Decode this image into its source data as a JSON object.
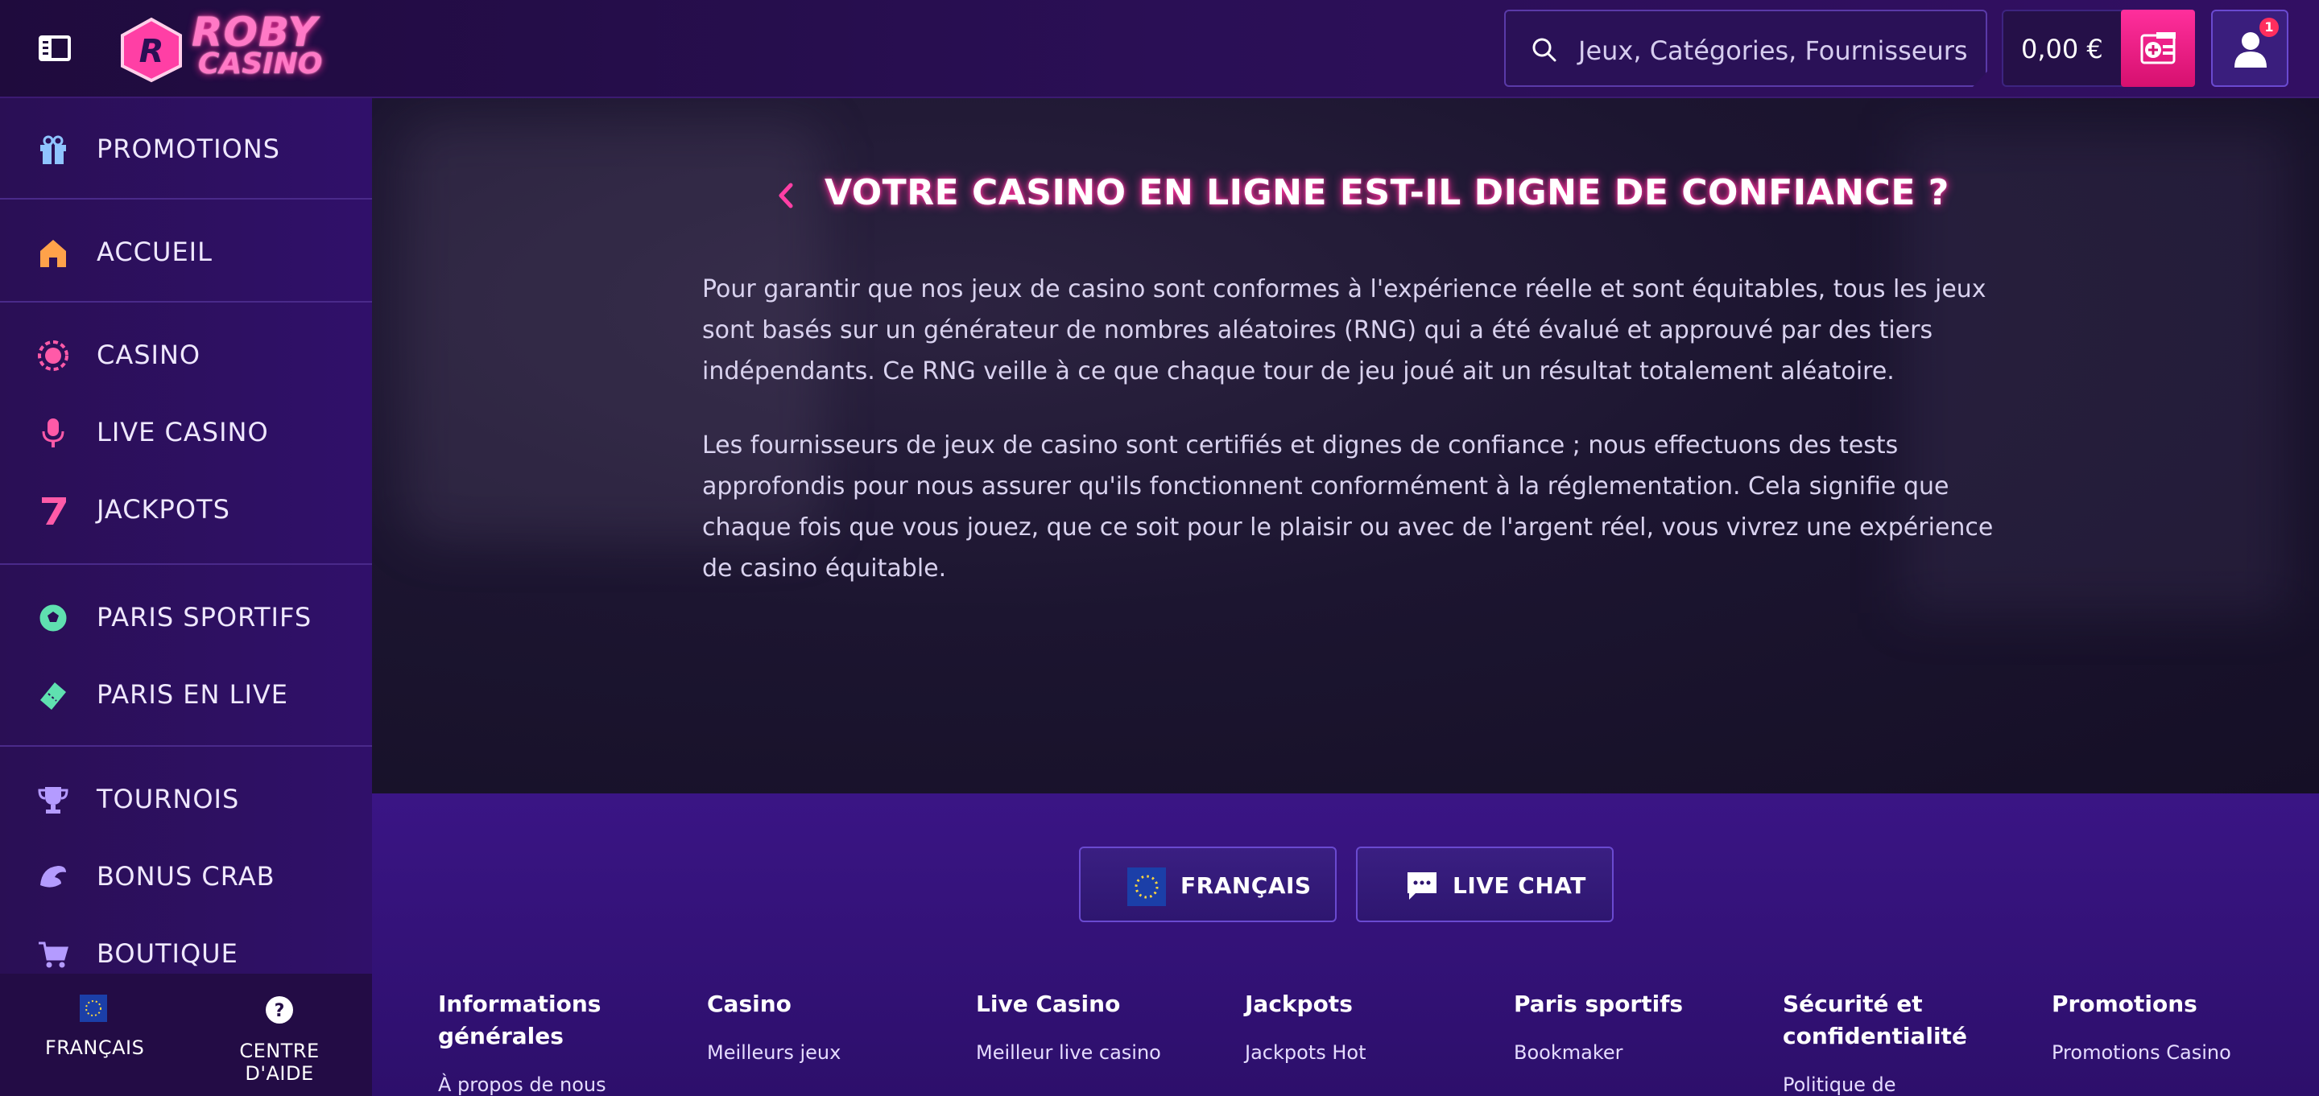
{
  "header": {
    "logo_line1": "ROBY",
    "logo_line2": "CASINO",
    "search_placeholder": "Jeux, Catégories, Fournisseurs",
    "balance": "0,00 €",
    "notification_count": "1"
  },
  "sidebar": {
    "items": [
      {
        "label": "PROMOTIONS",
        "icon": "gift-icon",
        "color": "#8fc4ff"
      },
      {
        "label": "ACCUEIL",
        "icon": "home-icon",
        "color": "#ffa24a"
      },
      {
        "label": "CASINO",
        "icon": "casino-chip-icon",
        "color": "#ff5aa8"
      },
      {
        "label": "LIVE CASINO",
        "icon": "microphone-icon",
        "color": "#ff5aa8"
      },
      {
        "label": "JACKPOTS",
        "icon": "seven-icon",
        "color": "#ff5aa8"
      },
      {
        "label": "PARIS SPORTIFS",
        "icon": "soccer-ball-icon",
        "color": "#5fe0b0"
      },
      {
        "label": "PARIS EN LIVE",
        "icon": "ticket-icon",
        "color": "#5fe0b0"
      },
      {
        "label": "TOURNOIS",
        "icon": "trophy-icon",
        "color": "#b49bff"
      },
      {
        "label": "BONUS CRAB",
        "icon": "crab-icon",
        "color": "#b49bff"
      },
      {
        "label": "BOUTIQUE",
        "icon": "cart-icon",
        "color": "#b49bff"
      }
    ],
    "footer": {
      "language": "FRANÇAIS",
      "help": "CENTRE D'AIDE"
    }
  },
  "article": {
    "title": "VOTRE CASINO EN LIGNE EST-IL DIGNE DE CONFIANCE ?",
    "paragraph1": "Pour garantir que nos jeux de casino sont conformes à l'expérience réelle et sont équitables, tous les jeux sont basés sur un générateur de nombres aléatoires (RNG) qui a été évalué et approuvé par des tiers indépendants. Ce RNG veille à ce que chaque tour de jeu joué ait un résultat totalement aléatoire.",
    "paragraph2": "Les fournisseurs de jeux de casino sont certifiés et dignes de confiance ; nous effectuons des tests approfondis pour nous assurer qu'ils fonctionnent conformément à la réglementation. Cela signifie que chaque fois que vous jouez, que ce soit pour le plaisir ou avec de l'argent réel, vous vivrez une expérience de casino équitable."
  },
  "footer": {
    "language_button": "FRANÇAIS",
    "chat_button": "LIVE CHAT",
    "columns": [
      {
        "heading": "Informations générales",
        "link": "À propos de nous"
      },
      {
        "heading": "Casino",
        "link": "Meilleurs jeux"
      },
      {
        "heading": "Live Casino",
        "link": "Meilleur live casino"
      },
      {
        "heading": "Jackpots",
        "link": "Jackpots Hot"
      },
      {
        "heading": "Paris sportifs",
        "link": "Bookmaker"
      },
      {
        "heading": "Sécurité et confidentialité",
        "link": "Politique de"
      },
      {
        "heading": "Promotions",
        "link": "Promotions Casino"
      }
    ]
  },
  "colors": {
    "accent_pink": "#ff2e9a",
    "sidebar_bg": "#2a0f55",
    "footer_bg": "#3a1585"
  }
}
